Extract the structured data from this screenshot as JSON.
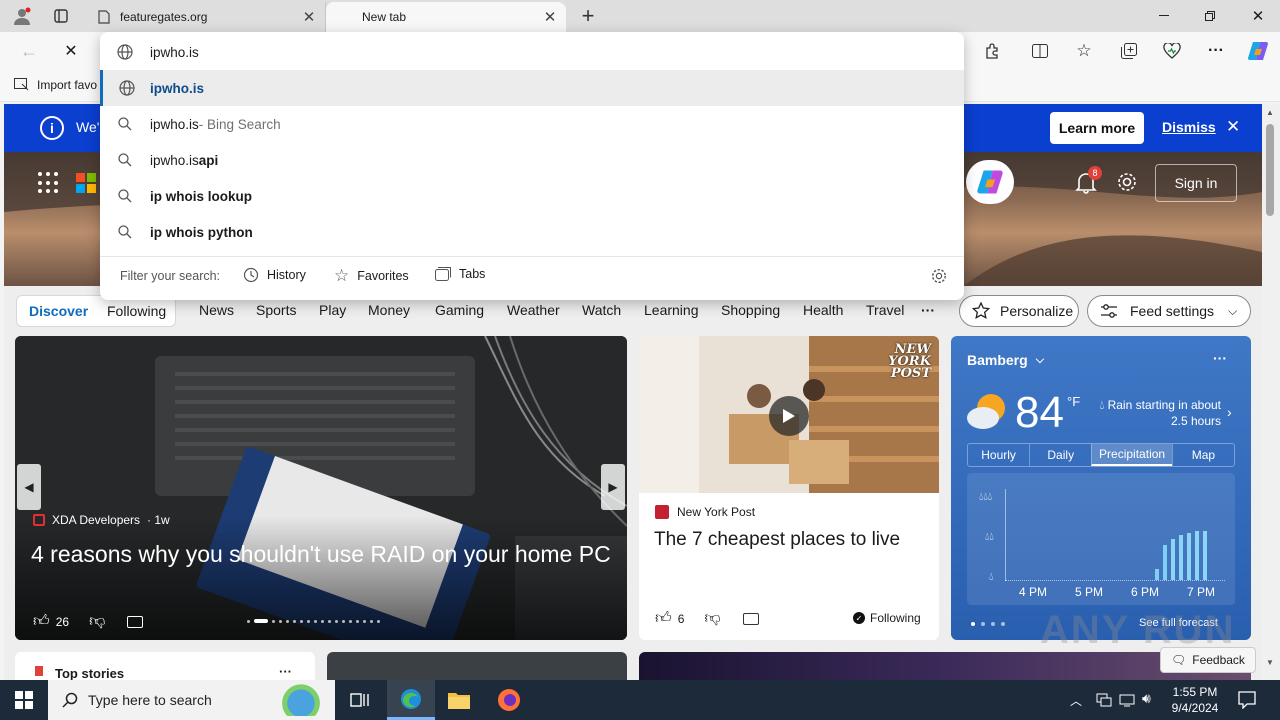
{
  "browser": {
    "tabs": [
      {
        "title": "featuregates.org"
      },
      {
        "title": "New tab"
      }
    ],
    "address_value": "ipwho.is",
    "suggestions": [
      {
        "main": "ipwho.is",
        "rest": "",
        "note": "",
        "icon": "globe-icon",
        "selected": true
      },
      {
        "main": "ipwho.is",
        "rest": "",
        "note": " - Bing Search",
        "icon": "search-icon"
      },
      {
        "main": "ipwho.is",
        "rest": " api",
        "note": "",
        "icon": "search-icon"
      },
      {
        "main": "",
        "rest": "ip whois lookup",
        "note": "",
        "icon": "search-icon"
      },
      {
        "main": "",
        "rest": "ip whois python",
        "note": "",
        "icon": "search-icon"
      }
    ],
    "filter": {
      "label": "Filter your search:",
      "history": "History",
      "favorites": "Favorites",
      "tabs": "Tabs"
    },
    "favbar_item": "Import favo"
  },
  "banner": {
    "text": "We'",
    "learn_more": "Learn more",
    "dismiss": "Dismiss"
  },
  "header": {
    "notification_count": "8",
    "sign_in": "Sign in"
  },
  "feed_nav": {
    "discover": "Discover",
    "following": "Following",
    "items": [
      "News",
      "Sports",
      "Play",
      "Money",
      "Gaming",
      "Weather",
      "Watch",
      "Learning",
      "Shopping",
      "Health",
      "Travel"
    ],
    "more": "···",
    "personalize": "Personalize",
    "feed_settings": "Feed settings"
  },
  "main_card": {
    "source": "XDA Developers",
    "age": "· 1w",
    "headline": "4 reasons why you shouldn't use RAID on your home PC",
    "likes": "26"
  },
  "side_card": {
    "source": "New York Post",
    "headline": "The 7 cheapest places to live",
    "likes": "6",
    "following": "Following",
    "logo_text": "NEW YORK POST"
  },
  "weather": {
    "city": "Bamberg",
    "temp": "84",
    "unit": "°F",
    "alert": "Rain starting in about 2.5 hours",
    "tabs": [
      "Hourly",
      "Daily",
      "Precipitation",
      "Map"
    ],
    "active_tab": "Precipitation",
    "times": [
      "4 PM",
      "5 PM",
      "6 PM",
      "7 PM"
    ],
    "see_full": "See full forecast"
  },
  "top_stories": "Top stories",
  "feedback": "Feedback",
  "taskbar": {
    "search_placeholder": "Type here to search",
    "time": "1:55 PM",
    "date": "9/4/2024"
  },
  "watermark": "ANY RUN",
  "colors": {
    "accent": "#0f6cbd",
    "banner": "#0b3fd0",
    "weather_bg": "#2f65b5",
    "taskbar": "#1c2a3a"
  }
}
